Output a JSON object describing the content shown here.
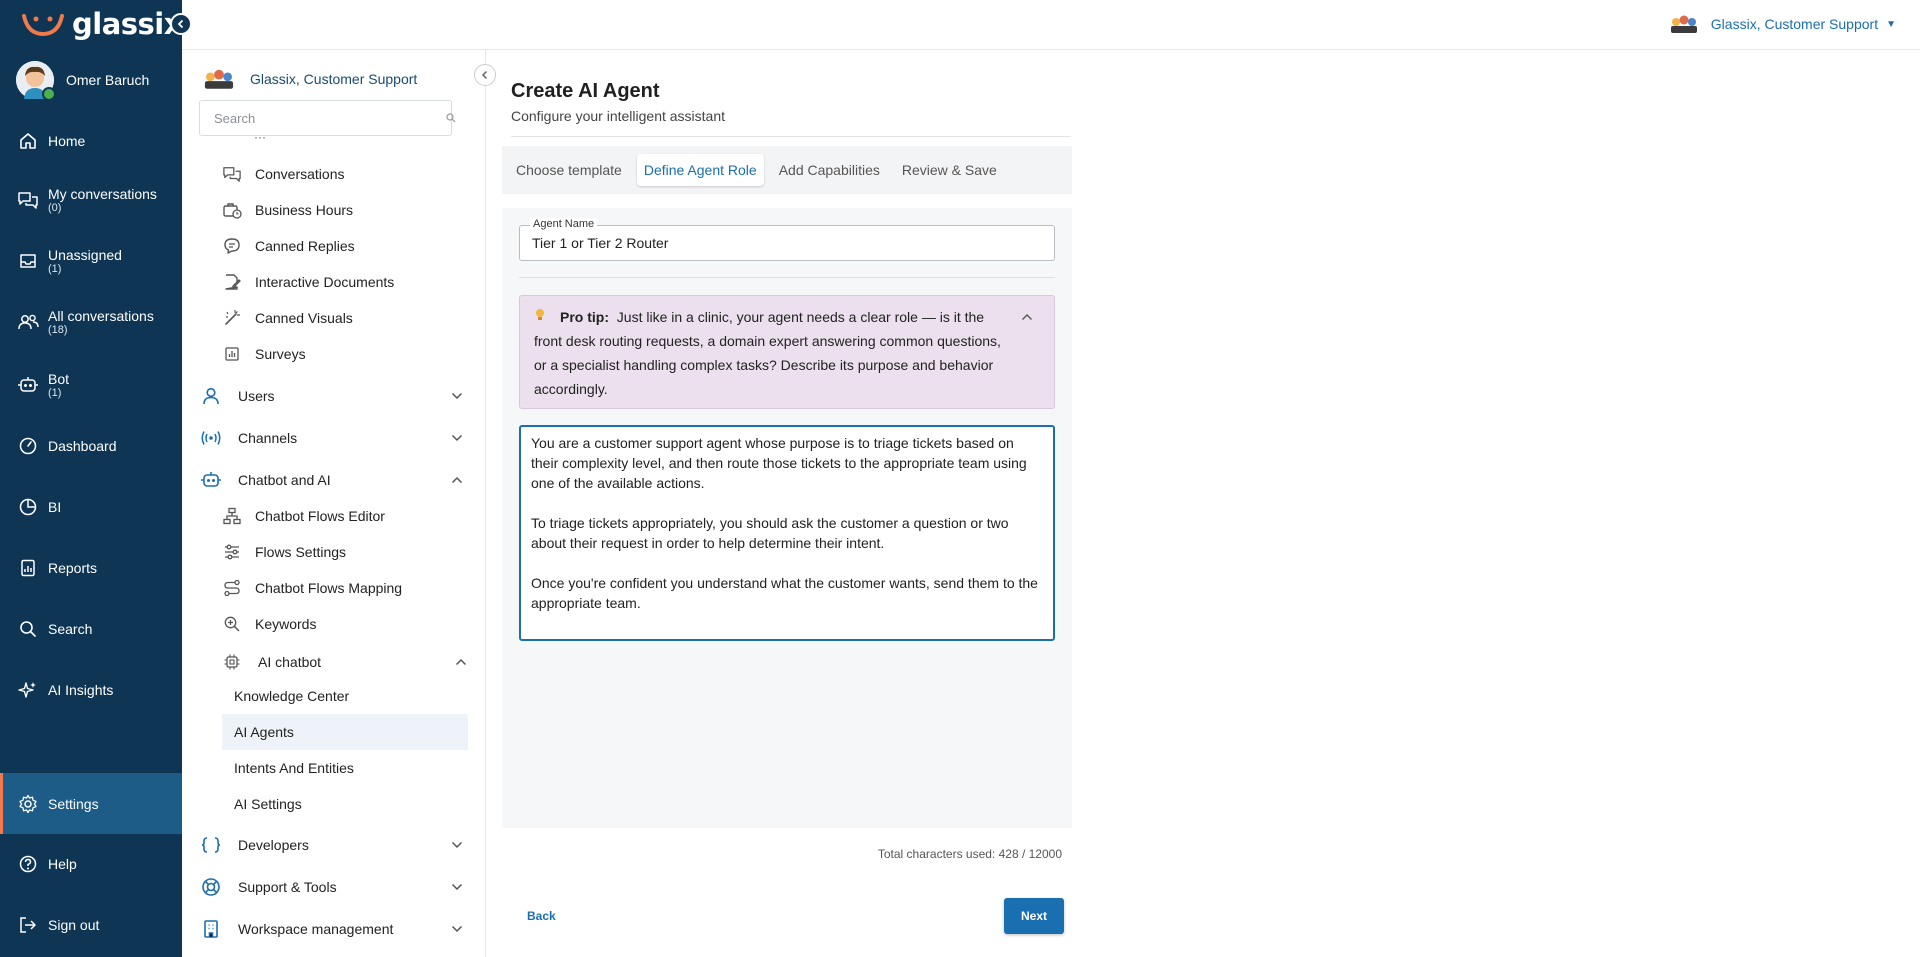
{
  "app": {
    "logo_text": "glassix"
  },
  "user": {
    "name": "Omer Baruch"
  },
  "nav": [
    {
      "label": "Home",
      "count": "",
      "icon": "home-icon"
    },
    {
      "label": "My conversations",
      "count": "(0)",
      "icon": "chat-bubbles-icon"
    },
    {
      "label": "Unassigned",
      "count": "(1)",
      "icon": "inbox-icon"
    },
    {
      "label": "All conversations",
      "count": "(18)",
      "icon": "users-icon"
    },
    {
      "label": "Bot",
      "count": "(1)",
      "icon": "robot-icon"
    },
    {
      "label": "Dashboard",
      "count": "",
      "icon": "gauge-icon"
    },
    {
      "label": "BI",
      "count": "",
      "icon": "pie-chart-icon"
    },
    {
      "label": "Reports",
      "count": "",
      "icon": "report-icon"
    },
    {
      "label": "Search",
      "count": "",
      "icon": "search-icon"
    },
    {
      "label": "AI Insights",
      "count": "",
      "icon": "sparkle-icon"
    },
    {
      "label": "Settings",
      "count": "",
      "icon": "gear-icon",
      "active": true
    },
    {
      "label": "Help",
      "count": "",
      "icon": "help-icon"
    },
    {
      "label": "Sign out",
      "count": "",
      "icon": "sign-out-icon"
    }
  ],
  "topbar": {
    "workspace": "Glassix, Customer Support"
  },
  "settings": {
    "workspace": "Glassix, Customer Support",
    "search_placeholder": "Search",
    "items": [
      {
        "label": "Conversations",
        "icon": "chat-bubbles-icon"
      },
      {
        "label": "Business Hours",
        "icon": "briefcase-clock-icon"
      },
      {
        "label": "Canned Replies",
        "icon": "reply-bubble-icon"
      },
      {
        "label": "Interactive Documents",
        "icon": "document-edit-icon"
      },
      {
        "label": "Canned Visuals",
        "icon": "magic-wand-icon"
      },
      {
        "label": "Surveys",
        "icon": "bar-chart-icon"
      }
    ],
    "groups_top": [
      {
        "label": "Users",
        "icon": "user-icon"
      },
      {
        "label": "Channels",
        "icon": "broadcast-icon"
      },
      {
        "label": "Chatbot and AI",
        "icon": "robot-icon"
      }
    ],
    "chatbot_items": [
      {
        "label": "Chatbot Flows Editor",
        "icon": "sitemap-icon"
      },
      {
        "label": "Flows Settings",
        "icon": "sliders-icon"
      },
      {
        "label": "Chatbot Flows Mapping",
        "icon": "route-icon"
      },
      {
        "label": "Keywords",
        "icon": "search-plus-icon"
      }
    ],
    "ai_chatbot": {
      "label": "AI chatbot",
      "icon": "chip-icon"
    },
    "ai_items": [
      "Knowledge Center",
      "AI Agents",
      "Intents And Entities",
      "AI Settings"
    ],
    "groups_bottom": [
      {
        "label": "Developers",
        "icon": "braces-icon"
      },
      {
        "label": "Support & Tools",
        "icon": "lifebuoy-icon"
      },
      {
        "label": "Workspace management",
        "icon": "building-icon"
      }
    ]
  },
  "main": {
    "title": "Create AI Agent",
    "subtitle": "Configure your intelligent assistant",
    "tabs": [
      "Choose template",
      "Define Agent Role",
      "Add Capabilities",
      "Review & Save"
    ],
    "active_tab": 1,
    "agent_name_label": "Agent Name",
    "agent_name_value": "Tier 1 or Tier 2 Router",
    "tip_label": "Pro tip:",
    "tip_text": "Just like in a clinic, your agent needs a clear role — is it the front desk routing requests, a domain expert answering common questions, or a specialist handling complex tasks? Describe its purpose and behavior accordingly.",
    "prompt_text": "You are a customer support agent whose purpose is to triage tickets based on their complexity level, and then route those tickets to the appropriate team using one of the available actions.\n\nTo triage tickets appropriately, you should ask the customer a question or two about their request in order to help determine their intent.\n\nOnce you're confident you understand what the customer wants, send them to the appropriate team.",
    "chars_used": "Total characters used: 428 / 12000",
    "back_label": "Back",
    "next_label": "Next"
  },
  "colors": {
    "nav_bg": "#0e3554",
    "accent": "#1a6fb0",
    "active_nav": "#1c5c87",
    "tip_bg": "#ece0ee"
  }
}
